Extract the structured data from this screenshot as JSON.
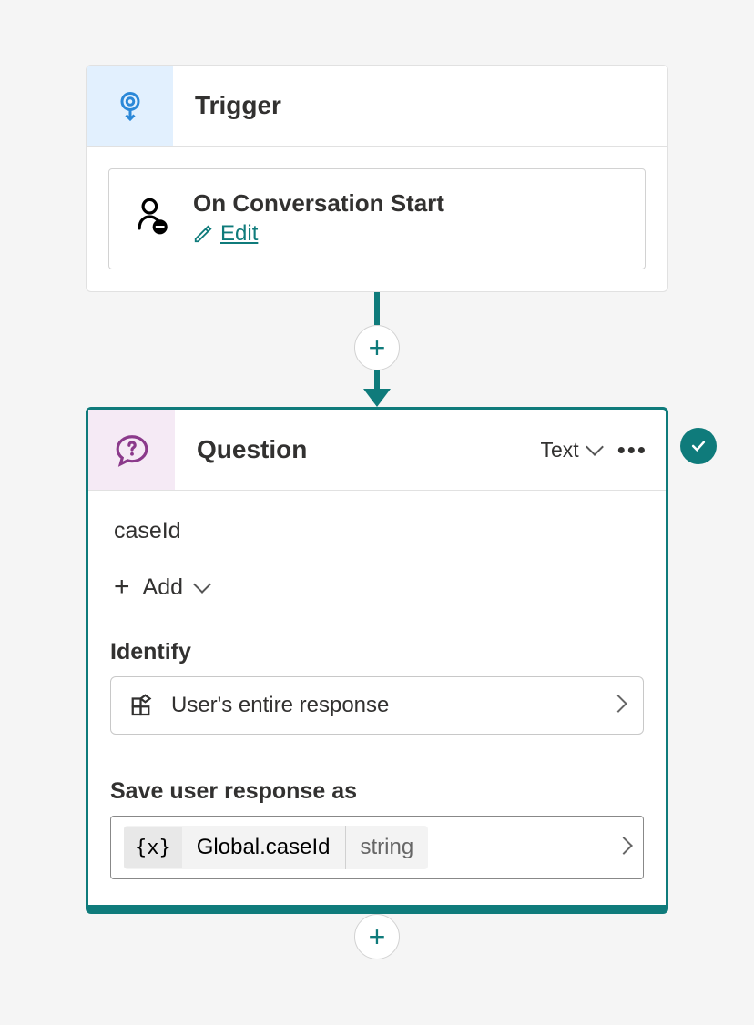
{
  "trigger": {
    "header_title": "Trigger",
    "event_name": "On Conversation Start",
    "edit_label": "Edit"
  },
  "question": {
    "header_title": "Question",
    "type_label": "Text",
    "prompt": "caseId",
    "add_label": "Add",
    "identify": {
      "section": "Identify",
      "value": "User's entire response"
    },
    "save": {
      "section": "Save user response as",
      "variable": "Global.caseId",
      "var_type": "string",
      "icon_text": "{x}"
    }
  }
}
